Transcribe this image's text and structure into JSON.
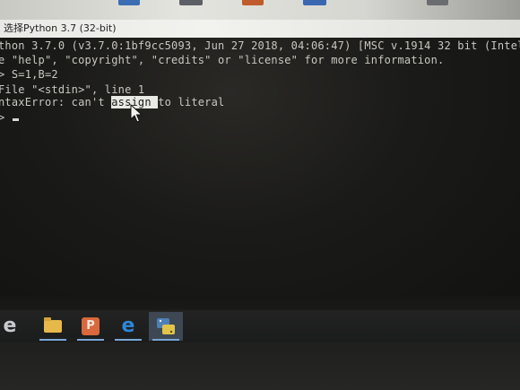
{
  "window": {
    "title": "选择Python 3.7 (32-bit)"
  },
  "console": {
    "lines": [
      "thon 3.7.0 (v3.7.0:1bf9cc5093, Jun 27 2018, 04:06:47) [MSC v.1914 32 bit (Intel",
      "e \"help\", \"copyright\", \"credits\" or \"license\" for more information.",
      "> S=1,B=2",
      "File \"<stdin>\", line 1",
      "ntaxError: can't ",
      ">"
    ],
    "selected_text": "assign ",
    "after_selection": "to literal"
  },
  "taskbar": {
    "items": [
      {
        "name": "internet-explorer",
        "icon": "ie-icon"
      },
      {
        "name": "file-explorer",
        "icon": "folder-icon"
      },
      {
        "name": "powerpoint",
        "icon": "powerpoint-icon"
      },
      {
        "name": "edge",
        "icon": "edge-icon"
      },
      {
        "name": "python",
        "icon": "python-icon",
        "active": true
      }
    ],
    "accent_color": "#7aa7d6"
  },
  "colors": {
    "console_bg": "#1a1a18",
    "console_text": "#c8c7c0",
    "selection_bg": "#e8e8e4"
  }
}
